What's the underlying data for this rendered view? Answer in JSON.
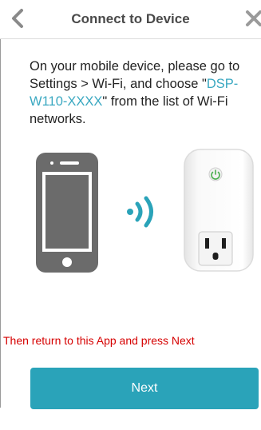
{
  "header": {
    "title": "Connect to Device",
    "back_icon": "chevron-left-icon",
    "close_icon": "close-icon"
  },
  "instructions": {
    "part1": "On your mobile device, please go to Settings > Wi-Fi, and choose \"",
    "ssid": "DSP-W110-XXXX",
    "part2": "\" from the list of Wi-Fi networks."
  },
  "illustration": {
    "phone_icon": "smartphone-icon",
    "wifi_icon": "wifi-signal-icon",
    "plug_icon": "smart-plug-icon"
  },
  "footer": {
    "return_text": "Then return to this App and press Next",
    "next_label": "Next"
  },
  "colors": {
    "accent": "#2aa3b9",
    "ssid_text": "#3aa8c1",
    "warning_text": "#d60000",
    "icon_gray": "#6b6b6b",
    "plug_led": "#4caf50"
  }
}
